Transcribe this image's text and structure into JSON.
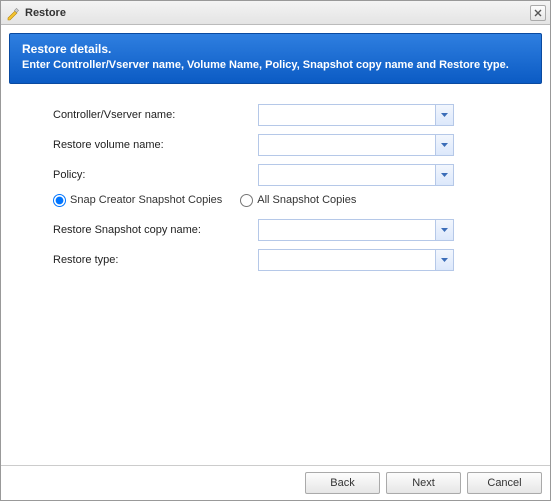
{
  "window": {
    "title": "Restore"
  },
  "banner": {
    "title": "Restore details.",
    "subtitle": "Enter Controller/Vserver name, Volume Name, Policy, Snapshot copy name and Restore type."
  },
  "form": {
    "controller_label": "Controller/Vserver name:",
    "controller_value": "",
    "volume_label": "Restore volume name:",
    "volume_value": "",
    "policy_label": "Policy:",
    "policy_value": "",
    "radio_snap_creator": "Snap Creator Snapshot Copies",
    "radio_all": "All Snapshot Copies",
    "snapshot_label": "Restore Snapshot copy name:",
    "snapshot_value": "",
    "restoretype_label": "Restore type:",
    "restoretype_value": ""
  },
  "buttons": {
    "back": "Back",
    "next": "Next",
    "cancel": "Cancel"
  }
}
